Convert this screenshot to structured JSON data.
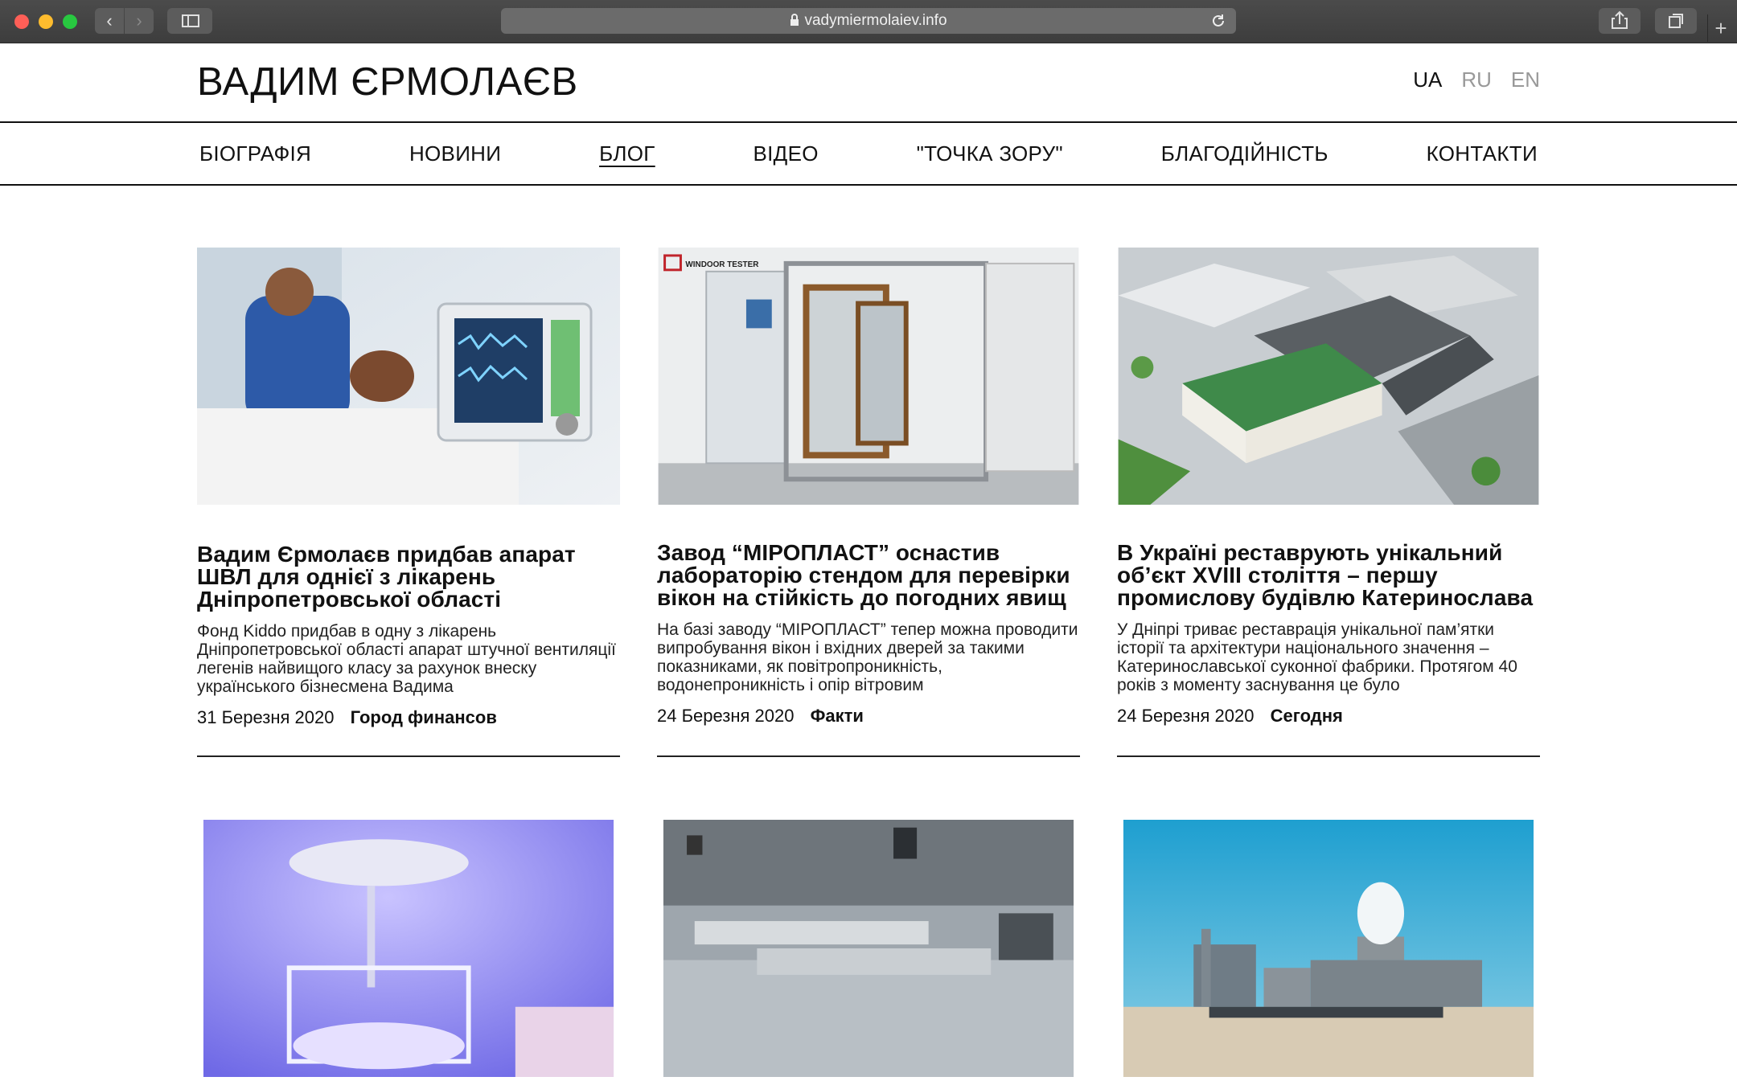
{
  "browser": {
    "url": "vadymiermolaiev.info",
    "icons": [
      "close-dot",
      "minimize-dot",
      "zoom-dot",
      "back-arrow-icon",
      "forward-arrow-icon",
      "sidebar-icon",
      "lock-icon",
      "reload-icon",
      "share-icon",
      "tabs-icon",
      "plus-icon"
    ]
  },
  "site": {
    "logo": "ВАДИМ ЄРМОЛАЄВ",
    "languages": [
      {
        "label": "UA",
        "active": true
      },
      {
        "label": "RU",
        "active": false
      },
      {
        "label": "EN",
        "active": false
      }
    ],
    "nav": [
      {
        "label": "БІОГРАФІЯ"
      },
      {
        "label": "НОВИНИ"
      },
      {
        "label": "БЛОГ",
        "active": true
      },
      {
        "label": "ВІДЕО"
      },
      {
        "label": "\"ТОЧКА ЗОРУ\""
      },
      {
        "label": "БЛАГОДІЙНІСТЬ"
      },
      {
        "label": "КОНТАКТИ"
      }
    ]
  },
  "posts": [
    {
      "title": "Вадим Єрмолаєв придбав апарат ШВЛ для однієї з лікарень Дніпропетровської області",
      "excerpt": "Фонд Kiddo придбав в одну з лікарень Дніпропетровської області апарат штучної вентиляції легенів найвищого класу за рахунок внеску українського бізнесмена Вадима",
      "date": "31 Березня 2020",
      "source": "Город финансов",
      "image": "ventilator-hospital-photo"
    },
    {
      "title": "Завод “МІРОПЛАСТ” оснастив лабораторію стендом для перевірки вікон на стійкість до погодних явищ",
      "excerpt": "На базі заводу “МІРОПЛАСТ” тепер можна проводити випробування вікон і вхідних дверей за такими показниками, як повітропроникність, водонепроникність і опір вітровим",
      "date": "24 Березня 2020",
      "source": "Факти",
      "image": "window-test-stand-photo",
      "image_label": "WINDOOR TESTER"
    },
    {
      "title": "В Україні реставрують унікальний об’єкт XVIII століття – першу промислову будівлю Катеринослава",
      "excerpt": "У Дніпрі триває реставрація унікальної пам’ятки історії та архітектури національного значення – Катеринославської суконної фабрики. Протягом 40 років з моменту заснування це було",
      "date": "24 Березня 2020",
      "source": "Сегодня",
      "image": "building-render-aerial"
    },
    {
      "image": "incubator-photo"
    },
    {
      "image": "factory-hall-photo"
    },
    {
      "image": "industrial-site-photo"
    }
  ],
  "colors": {
    "accent": "#111111",
    "muted": "#999999"
  }
}
